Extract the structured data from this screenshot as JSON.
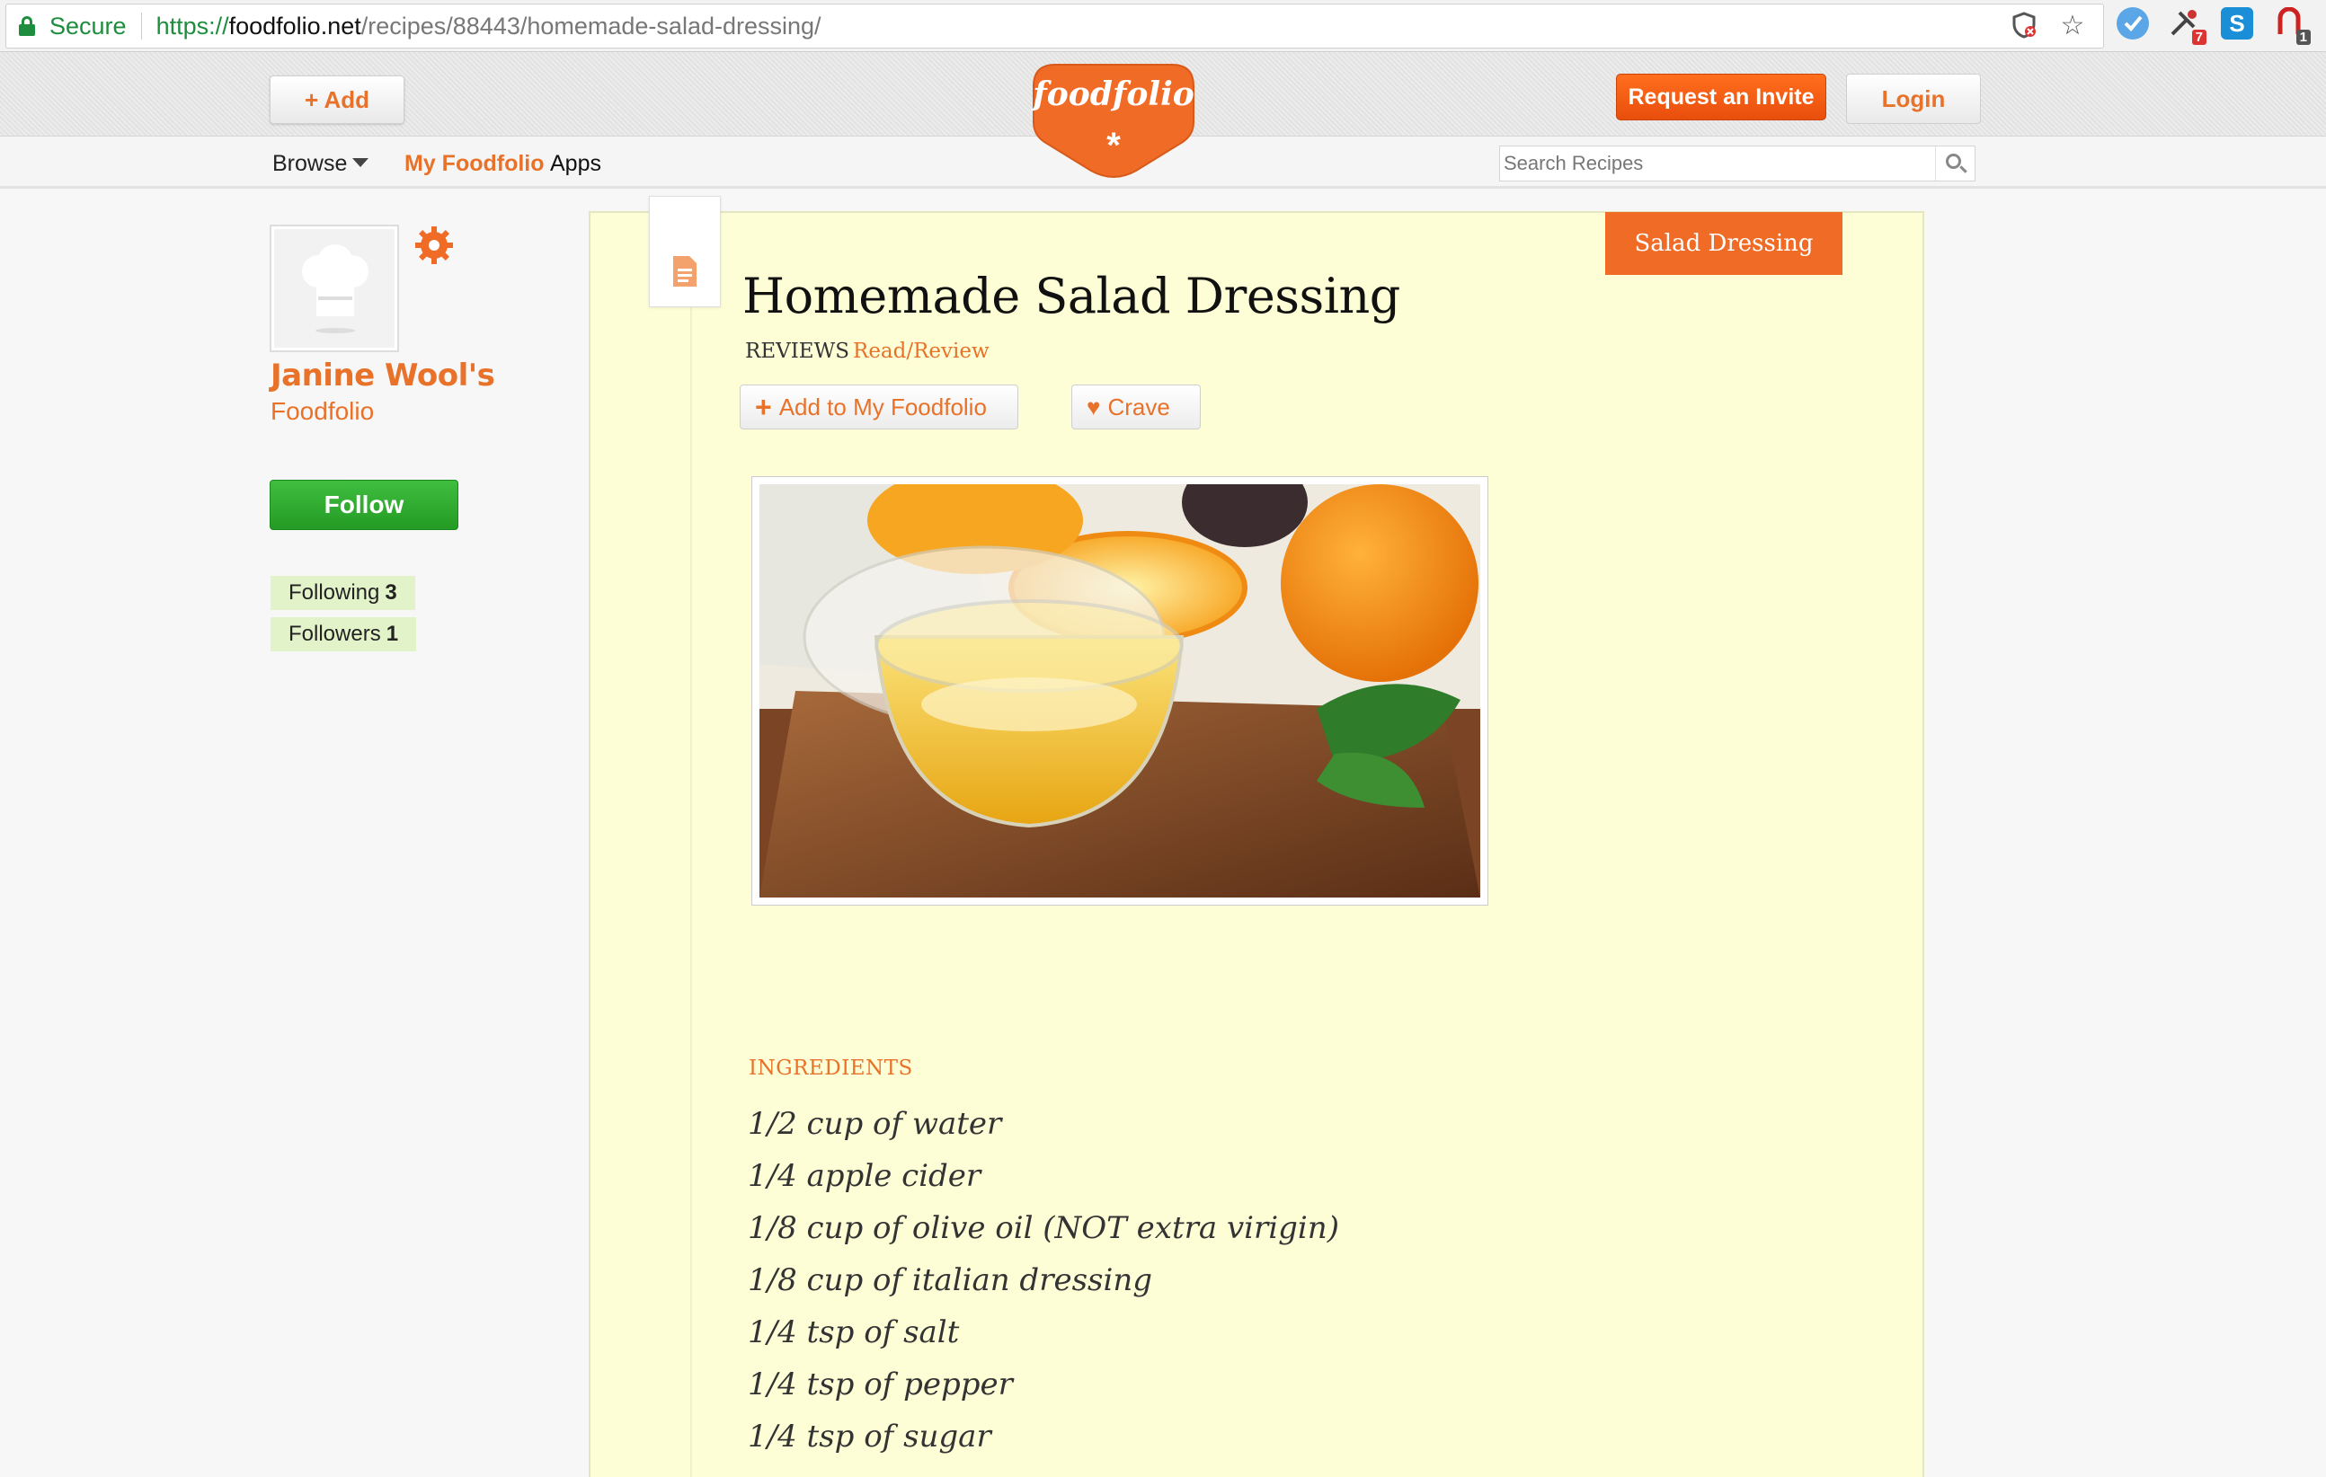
{
  "browser": {
    "secure_label": "Secure",
    "url_proto": "https://",
    "url_host": "foodfolio.net",
    "url_path": "/recipes/88443/homemade-salad-dressing/",
    "extension_badges": [
      "7",
      "1"
    ]
  },
  "header": {
    "add_label": "+ Add",
    "logo_text": "foodfolio",
    "logo_mark": "*",
    "invite_label": "Request an Invite",
    "login_label": "Login"
  },
  "nav": {
    "browse_label": "Browse",
    "my_label": "My Foodfolio",
    "apps_label": "Apps",
    "search_placeholder": "Search Recipes"
  },
  "profile": {
    "name": "Janine Wool's",
    "subtitle": "Foodfolio",
    "follow_label": "Follow",
    "following_label": "Following",
    "following_count": "3",
    "followers_label": "Followers",
    "followers_count": "1"
  },
  "recipe": {
    "category_tag": "Salad Dressing",
    "title": "Homemade Salad Dressing",
    "reviews_label": "REVIEWS",
    "reviews_link": "Read/Review",
    "add_label": "Add to My Foodfolio",
    "crave_label": "Crave",
    "ingredients_heading": "INGREDIENTS",
    "ingredients": [
      "1/2 cup of water",
      "1/4 apple cider",
      "1/8 cup of olive oil (NOT extra virigin)",
      "1/8 cup of italian dressing",
      "1/4 tsp of salt",
      "1/4 tsp of pepper",
      "1/4 tsp of sugar"
    ]
  },
  "colors": {
    "brand_orange": "#e8722a",
    "follow_green": "#2aa52a",
    "card_bg": "#fefed6"
  }
}
